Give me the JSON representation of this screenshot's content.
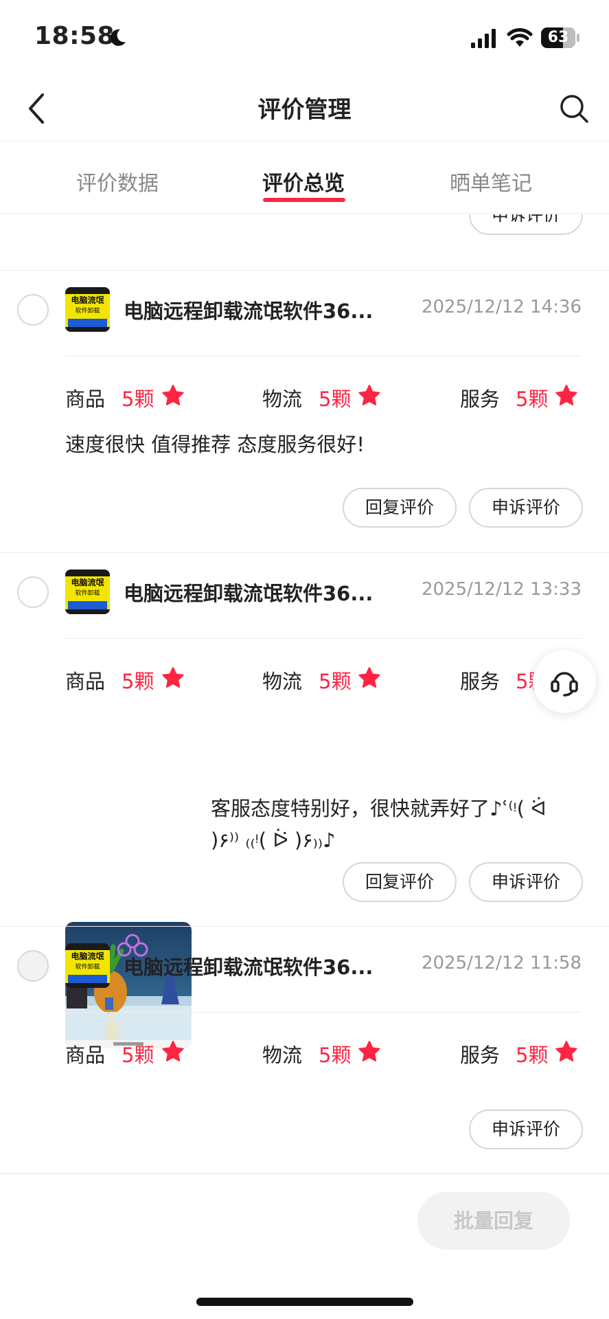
{
  "status_bar": {
    "time": "18:58",
    "battery": "63"
  },
  "nav": {
    "title": "评价管理"
  },
  "tabs": [
    {
      "label": "评价数据",
      "active": false
    },
    {
      "label": "评价总览",
      "active": true
    },
    {
      "label": "晒单笔记",
      "active": false
    }
  ],
  "partial_top_button": "申诉评价",
  "rating_labels": {
    "product": "商品",
    "logistics": "物流",
    "service": "服务"
  },
  "reviews": [
    {
      "product_name": "电脑远程卸载流氓软件36...",
      "date": "2025/12/12 14:36",
      "ratings": {
        "product": "5颗",
        "logistics": "5颗",
        "service": "5颗"
      },
      "text": "速度很快 值得推荐 态度服务很好!",
      "reply_button": "回复评价",
      "appeal_button": "申诉评价"
    },
    {
      "product_name": "电脑远程卸载流氓软件36...",
      "date": "2025/12/12 13:33",
      "ratings": {
        "product": "5颗",
        "logistics": "5颗",
        "service": "5颗"
      },
      "text_line1": "客服态度特别好，很快就弄好了♪ʿ⁽ᵎ(  ᐛ",
      "text_line2": ")۶⁾⁾ ₍₍ᵎ( ᐖ )۶₎₎♪",
      "reply_button": "回复评价",
      "appeal_button": "申诉评价"
    },
    {
      "product_name": "电脑远程卸载流氓软件36...",
      "date": "2025/12/12 11:58",
      "ratings": {
        "product": "5颗",
        "logistics": "5颗",
        "service": "5颗"
      },
      "appeal_button": "申诉评价"
    }
  ],
  "thumb_text": {
    "line1": "电脑流氓",
    "line2": "软件卸载"
  },
  "batch_reply": "批量回复",
  "colors": {
    "accent": "#ff2442",
    "thumb_bg": "#f2e600"
  }
}
